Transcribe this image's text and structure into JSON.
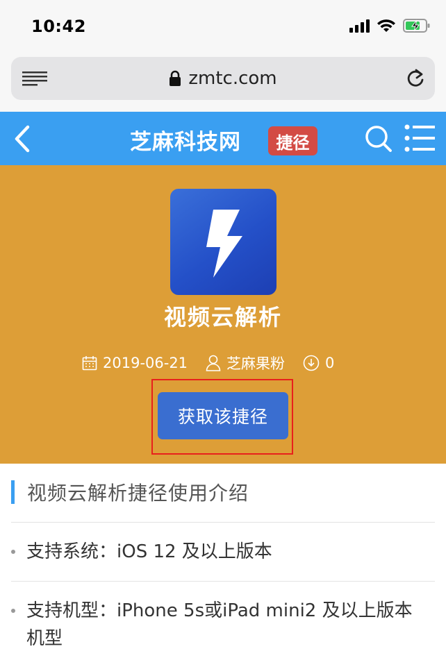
{
  "status_bar": {
    "time": "10:42",
    "battery_icon": "battery-charging-icon"
  },
  "browser": {
    "url": "zmtc.com"
  },
  "site_header": {
    "title": "芝麻科技网",
    "badge": "捷径"
  },
  "hero": {
    "app_name": "视频云解析",
    "date": "2019-06-21",
    "author": "芝麻果粉",
    "downloads": "0",
    "get_button": "获取该捷径"
  },
  "content": {
    "heading": "视频云解析捷径使用介绍",
    "items": [
      "支持系统：iOS 12 及以上版本",
      "支持机型：iPhone 5s或iPad mini2 及以上版本机型"
    ]
  },
  "colors": {
    "header_blue": "#3a9ff1",
    "hero_orange": "#dd9e37",
    "button_blue": "#3a6ed0",
    "badge_red": "#d34b44",
    "highlight_red": "#e8201c"
  }
}
